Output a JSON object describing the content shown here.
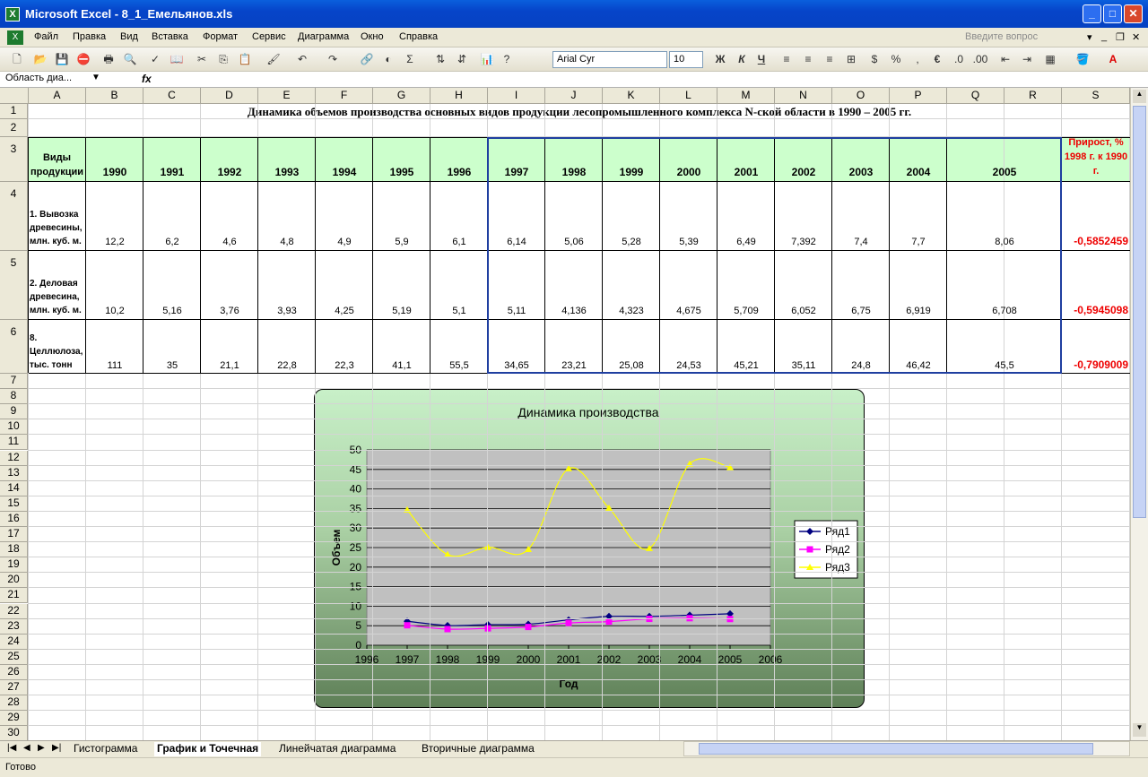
{
  "window": {
    "title": "Microsoft Excel - 8_1_Емельянов.xls"
  },
  "menu": [
    "Файл",
    "Правка",
    "Вид",
    "Вставка",
    "Формат",
    "Сервис",
    "Диаграмма",
    "Окно",
    "Справка"
  ],
  "question_placeholder": "Введите вопрос",
  "toolbar": {
    "font": "Arial Cyr",
    "size": "10",
    "bold": "Ж",
    "italic": "К",
    "underline": "Ч"
  },
  "formula_bar": {
    "name_box": "Область диа...",
    "fx": "fx"
  },
  "columns": [
    "A",
    "B",
    "C",
    "D",
    "E",
    "F",
    "G",
    "H",
    "I",
    "J",
    "K",
    "L",
    "M",
    "N",
    "O",
    "P",
    "Q",
    "R",
    "S"
  ],
  "rows": [
    "1",
    "2",
    "3",
    "4",
    "5",
    "6",
    "7",
    "8",
    "9",
    "10",
    "11",
    "12",
    "13",
    "14",
    "15",
    "16",
    "17",
    "18",
    "19",
    "20",
    "21",
    "22",
    "23",
    "24",
    "25",
    "26",
    "27",
    "28",
    "29",
    "30"
  ],
  "sheet": {
    "title": "Динамика объемов производства основных видов продукции лесопромышленного комплекса N-ской области в 1990 – 2005 гг.",
    "header_label": "Виды продукции",
    "years": [
      "1990",
      "1991",
      "1992",
      "1993",
      "1994",
      "1995",
      "1996",
      "1997",
      "1998",
      "1999",
      "2000",
      "2001",
      "2002",
      "2003",
      "2004",
      "2005"
    ],
    "growth_header": "Прирост, % 1998 г. к 1990 г.",
    "products": [
      {
        "label": "1. Вывозка древесины, млн. куб. м.",
        "values": [
          "12,2",
          "6,2",
          "4,6",
          "4,8",
          "4,9",
          "5,9",
          "6,1",
          "6,14",
          "5,06",
          "5,28",
          "5,39",
          "6,49",
          "7,392",
          "7,4",
          "7,7",
          "8,06"
        ],
        "growth": "-0,5852459"
      },
      {
        "label": "2. Деловая древесина, млн. куб. м.",
        "values": [
          "10,2",
          "5,16",
          "3,76",
          "3,93",
          "4,25",
          "5,19",
          "5,1",
          "5,11",
          "4,136",
          "4,323",
          "4,675",
          "5,709",
          "6,052",
          "6,75",
          "6,919",
          "6,708"
        ],
        "growth": "-0,5945098"
      },
      {
        "label": "8. Целлюлоза, тыс. тонн",
        "values": [
          "111",
          "35",
          "21,1",
          "22,8",
          "22,3",
          "41,1",
          "55,5",
          "34,65",
          "23,21",
          "25,08",
          "24,53",
          "45,21",
          "35,11",
          "24,8",
          "46,42",
          "45,5"
        ],
        "growth": "-0,7909009"
      }
    ]
  },
  "chart_data": {
    "type": "line",
    "title": "Динамика производства",
    "xlabel": "Год",
    "ylabel": "Объем",
    "xlim": [
      1996,
      2006
    ],
    "ylim": [
      0,
      50
    ],
    "x_ticks": [
      "1996",
      "1997",
      "1998",
      "1999",
      "2000",
      "2001",
      "2002",
      "2003",
      "2004",
      "2005",
      "2006"
    ],
    "y_ticks": [
      "0",
      "5",
      "10",
      "15",
      "20",
      "25",
      "30",
      "35",
      "40",
      "45",
      "50"
    ],
    "x": [
      1997,
      1998,
      1999,
      2000,
      2001,
      2002,
      2003,
      2004,
      2005
    ],
    "series": [
      {
        "name": "Ряд1",
        "color": "#000080",
        "marker": "diamond",
        "values": [
          6.14,
          5.06,
          5.28,
          5.39,
          6.49,
          7.392,
          7.4,
          7.7,
          8.06
        ]
      },
      {
        "name": "Ряд2",
        "color": "#ff00ff",
        "marker": "square",
        "values": [
          5.11,
          4.136,
          4.323,
          4.675,
          5.709,
          6.052,
          6.75,
          6.919,
          6.708
        ]
      },
      {
        "name": "Ряд3",
        "color": "#ffff00",
        "marker": "triangle",
        "values": [
          34.65,
          23.21,
          25.08,
          24.53,
          45.21,
          35.11,
          24.8,
          46.42,
          45.5
        ]
      }
    ],
    "legend_position": "right",
    "grid": true
  },
  "sheet_tabs": [
    "Гистограмма",
    "График и Точечная",
    "Линейчатая диаграмма",
    "Вторичные диаграмма"
  ],
  "active_tab": "График и Точечная",
  "status": "Готово"
}
